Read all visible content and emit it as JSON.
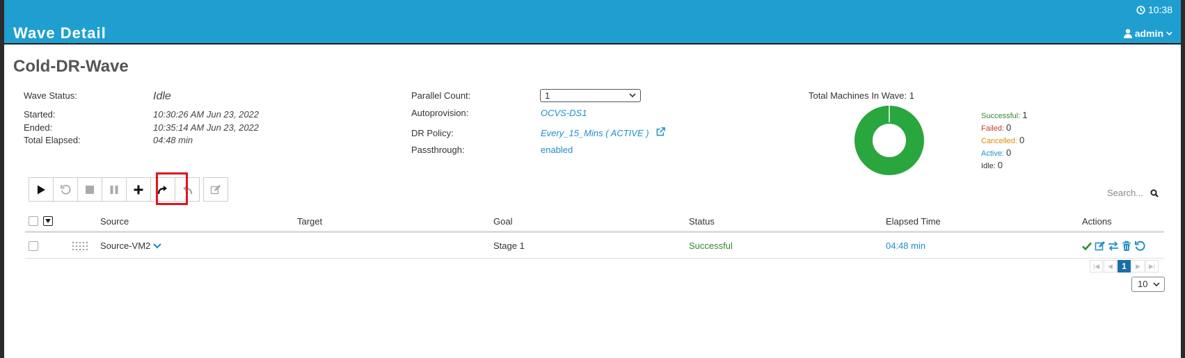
{
  "header": {
    "title": "Wave Detail",
    "time": "10:38",
    "user": "admin"
  },
  "wave": {
    "name": "Cold-DR-Wave",
    "status_label": "Wave Status:",
    "status": "Idle",
    "started_label": "Started:",
    "started": "10:30:26 AM Jun 23, 2022",
    "ended_label": "Ended:",
    "ended": "10:35:14 AM Jun 23, 2022",
    "elapsed_label": "Total Elapsed:",
    "elapsed": "04:48 min"
  },
  "settings": {
    "parallel_label": "Parallel Count:",
    "parallel_value": "1",
    "autoprovision_label": "Autoprovision:",
    "autoprovision_value": "OCVS-DS1",
    "dr_policy_label": "DR Policy:",
    "dr_policy_value": "Every_15_Mins ( ACTIVE )",
    "passthrough_label": "Passthrough:",
    "passthrough_value": "enabled"
  },
  "summary": {
    "title": "Total Machines In Wave: 1",
    "legend": [
      {
        "label": "Successful:",
        "count": "1",
        "color": "#2e8b2e"
      },
      {
        "label": "Failed:",
        "count": "0",
        "color": "#c0392b"
      },
      {
        "label": "Cancelled:",
        "count": "0",
        "color": "#e08a00"
      },
      {
        "label": "Active:",
        "count": "0",
        "color": "#1f8fc7"
      },
      {
        "label": "Idle:",
        "count": "0",
        "color": "#333333"
      }
    ],
    "donut_color": "#2aa63f"
  },
  "toolbar": {
    "buttons": [
      "play-icon",
      "restart-icon",
      "stop-icon",
      "pause-icon",
      "add-icon",
      "forward-icon",
      "reply-icon",
      "edit-icon"
    ]
  },
  "search": {
    "placeholder": "Search..."
  },
  "table": {
    "columns": [
      "Source",
      "Target",
      "Goal",
      "Status",
      "Elapsed Time",
      "Actions"
    ],
    "rows": [
      {
        "source": "Source-VM2",
        "target": "",
        "goal": "Stage 1",
        "status": "Successful",
        "elapsed": "04:48 min"
      }
    ]
  },
  "pagination": {
    "current_page": "1",
    "page_size": "10"
  }
}
